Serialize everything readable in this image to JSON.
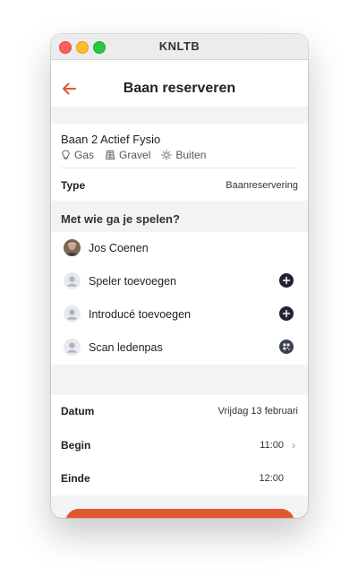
{
  "window": {
    "title": "KNLTB"
  },
  "header": {
    "title": "Baan reserveren",
    "back_icon": "arrow-left-icon",
    "accent_color": "#e2572e"
  },
  "court": {
    "name": "Baan 2 Actief Fysio",
    "attributes": [
      {
        "icon": "lightbulb-icon",
        "label": "Gas"
      },
      {
        "icon": "court-surface-icon",
        "label": "Gravel"
      },
      {
        "icon": "sun-icon",
        "label": "Buiten"
      }
    ],
    "type_label": "Type",
    "type_value": "Baanreservering"
  },
  "players": {
    "title": "Met wie ga je spelen?",
    "items": [
      {
        "label": "Jos Coenen",
        "avatar": "photo",
        "action": null
      },
      {
        "label": "Speler toevoegen",
        "avatar": "placeholder",
        "action": "plus-icon"
      },
      {
        "label": "Introducé toevoegen",
        "avatar": "placeholder",
        "action": "plus-icon"
      },
      {
        "label": "Scan ledenpas",
        "avatar": "placeholder",
        "action": "qr-icon"
      }
    ]
  },
  "datetime": {
    "date_label": "Datum",
    "date_value": "Vrijdag 13 februari",
    "start_label": "Begin",
    "start_value": "11:00",
    "end_label": "Einde",
    "end_value": "12:00"
  }
}
